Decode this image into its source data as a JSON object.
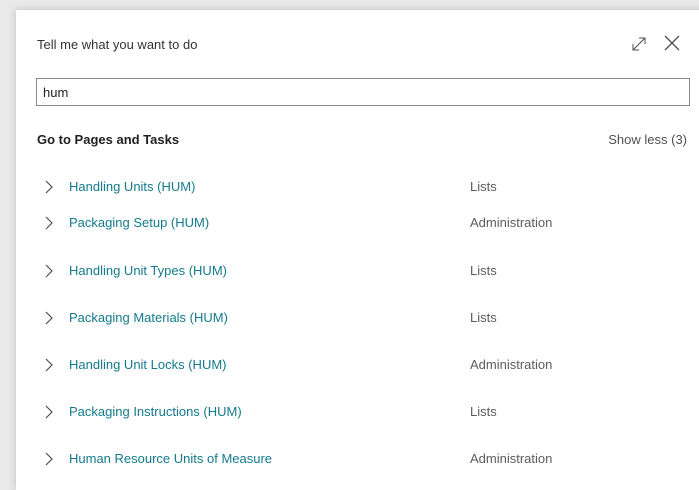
{
  "dialog": {
    "title": "Tell me what you want to do",
    "expand_icon": "expand-diagonal-icon",
    "close_icon": "close-icon"
  },
  "search": {
    "value": "hum"
  },
  "section": {
    "header": "Go to Pages and Tasks",
    "toggle_label": "Show less (3)"
  },
  "results": [
    {
      "name": "Handling Units (HUM)",
      "category": "Lists"
    },
    {
      "name": "Packaging Setup (HUM)",
      "category": "Administration"
    },
    {
      "name": "Handling Unit Types (HUM)",
      "category": "Lists"
    },
    {
      "name": "Packaging Materials (HUM)",
      "category": "Lists"
    },
    {
      "name": "Handling Unit Locks (HUM)",
      "category": "Administration"
    },
    {
      "name": "Packaging Instructions (HUM)",
      "category": "Lists"
    },
    {
      "name": "Human Resource Units of Measure",
      "category": "Administration"
    }
  ],
  "colors": {
    "link": "#137a8c",
    "category_text": "#5c5c5c"
  }
}
